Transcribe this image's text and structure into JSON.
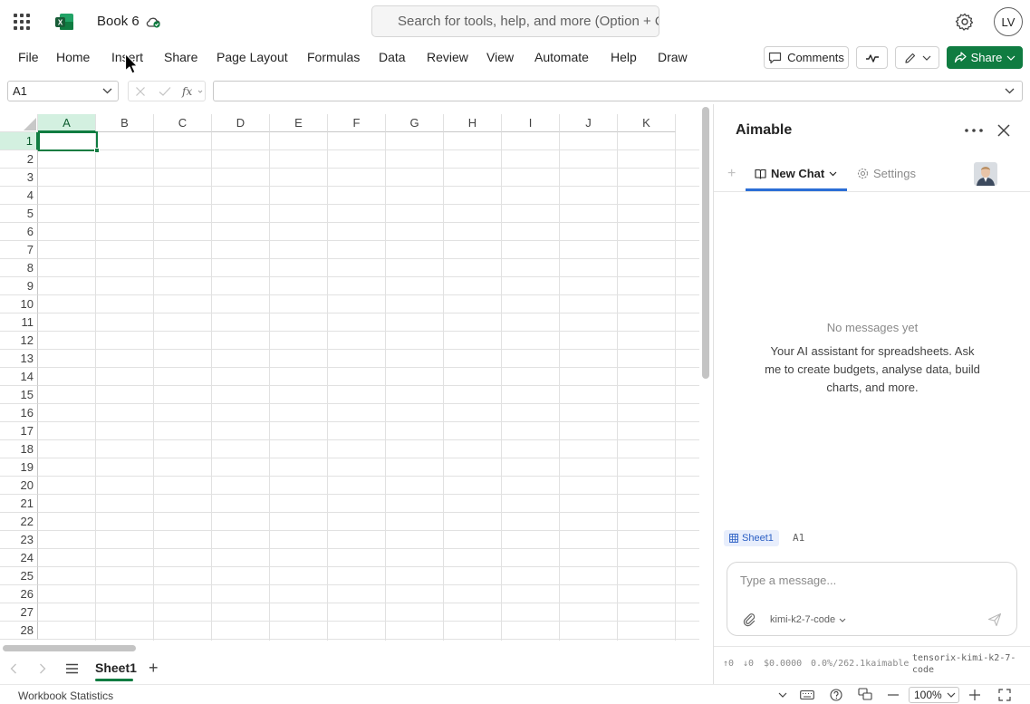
{
  "app": {
    "book_title": "Book 6",
    "search_placeholder": "Search for tools, help, and more (Option + Q)",
    "user_initials": "LV"
  },
  "ribbon": {
    "tabs": [
      "File",
      "Home",
      "Insert",
      "Share",
      "Page Layout",
      "Formulas",
      "Data",
      "Review",
      "View",
      "Automate",
      "Help",
      "Draw"
    ],
    "comments_label": "Comments",
    "share_label": "Share"
  },
  "formula_bar": {
    "name_box": "A1",
    "formula": ""
  },
  "grid": {
    "columns": [
      "A",
      "B",
      "C",
      "D",
      "E",
      "F",
      "G",
      "H",
      "I",
      "J",
      "K"
    ],
    "rows": [
      "1",
      "2",
      "3",
      "4",
      "5",
      "6",
      "7",
      "8",
      "9",
      "10",
      "11",
      "12",
      "13",
      "14",
      "15",
      "16",
      "17",
      "18",
      "19",
      "20",
      "21",
      "22",
      "23",
      "24",
      "25",
      "26",
      "27",
      "28"
    ],
    "selected_column": "A",
    "selected_row": "1"
  },
  "sheets": {
    "active": "Sheet1",
    "add_label": "+"
  },
  "statusbar": {
    "workbook_stats": "Workbook Statistics",
    "zoom": "100%"
  },
  "panel": {
    "title": "Aimable",
    "tab_new_chat": "New Chat",
    "tab_settings": "Settings",
    "empty_title": "No messages yet",
    "empty_desc": "Your AI assistant for spreadsheets. Ask me to create budgets, analyse data, build charts, and more.",
    "context_sheet": "Sheet1",
    "context_cell": "A1",
    "message_placeholder": "Type a message...",
    "model": "kimi-k2-7-code",
    "footer": {
      "tokens_up": "↑0",
      "tokens_down": "↓0",
      "cost": "$0.0000",
      "usage": "0.0%/262.1k",
      "brand": "aimable",
      "model_full": "tensorix-kimi-k2-7-code"
    }
  },
  "colors": {
    "excel_green": "#107c41",
    "selection_fill": "#d3f0e0",
    "panel_accent": "#2b6ed6"
  }
}
